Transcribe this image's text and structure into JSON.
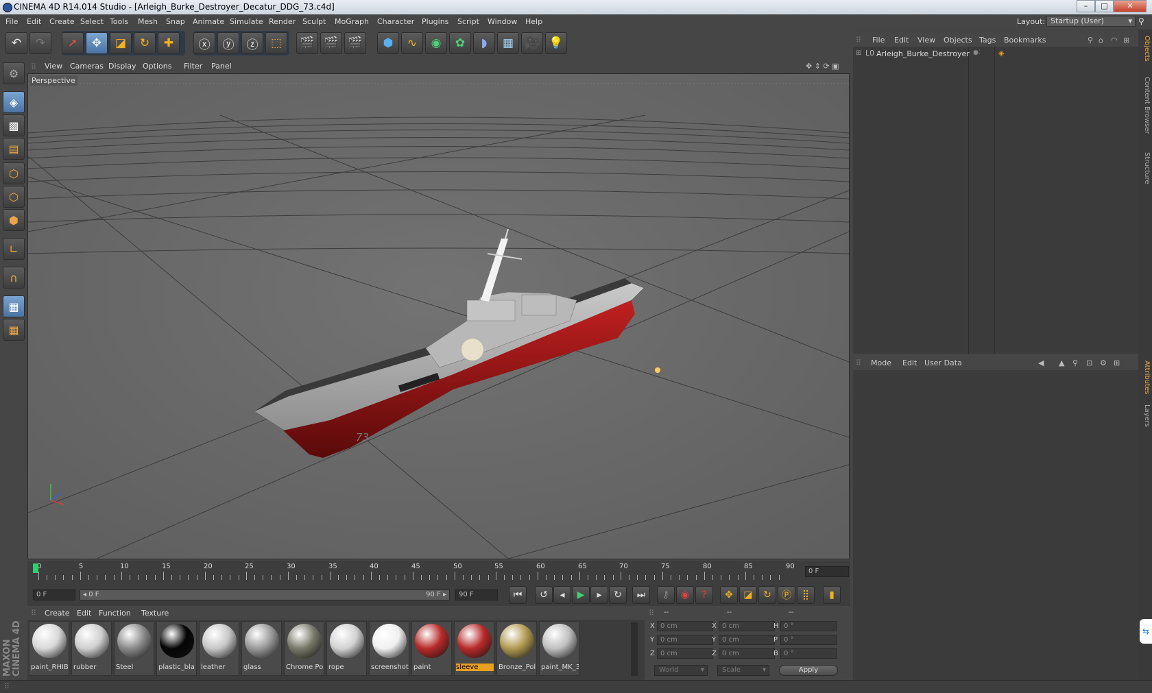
{
  "window": {
    "title": "CINEMA 4D R14.014 Studio - [Arleigh_Burke_Destroyer_Decatur_DDG_73.c4d]",
    "minimize": "–",
    "maximize": "□",
    "close": "✕"
  },
  "menubar": {
    "items": [
      "File",
      "Edit",
      "Create",
      "Select",
      "Tools",
      "Mesh",
      "Snap",
      "Animate",
      "Simulate",
      "Render",
      "Sculpt",
      "MoGraph",
      "Character",
      "Plugins",
      "Script",
      "Window",
      "Help"
    ],
    "layout_label": "Layout:",
    "layout_value": "Startup (User)"
  },
  "viewport": {
    "menu": [
      "View",
      "Cameras",
      "Display",
      "Options",
      "Filter",
      "Panel"
    ],
    "label": "Perspective",
    "hull_number": "73"
  },
  "timeline": {
    "ticks": [
      "0",
      "5",
      "10",
      "15",
      "20",
      "25",
      "30",
      "35",
      "40",
      "45",
      "50",
      "55",
      "60",
      "65",
      "70",
      "75",
      "80",
      "85",
      "90"
    ],
    "current_frame": "0 F",
    "start_field": "0 F",
    "range_start": "◂ 0 F",
    "range_end": "90 F ▸",
    "end_field": "90 F"
  },
  "materials": {
    "menu": [
      "Create",
      "Edit",
      "Function",
      "Texture"
    ],
    "items": [
      {
        "name": "paint_RHIB",
        "color": "#d8d8d8",
        "selected": false
      },
      {
        "name": "rubber",
        "color": "#cfcfcf",
        "selected": false
      },
      {
        "name": "Steel",
        "color": "#8a8a8a",
        "selected": false
      },
      {
        "name": "plastic_bla",
        "color": "#050505",
        "selected": false
      },
      {
        "name": "leather",
        "color": "#c8c8c8",
        "selected": false
      },
      {
        "name": "glass",
        "color": "#9a9a9a",
        "selected": false
      },
      {
        "name": "Chrome Po",
        "color": "#7a7a6a",
        "selected": false
      },
      {
        "name": "rope",
        "color": "#d2d2d2",
        "selected": false
      },
      {
        "name": "screenshot",
        "color": "#f0f0f0",
        "selected": false
      },
      {
        "name": "paint",
        "color": "#b82a2a",
        "selected": false
      },
      {
        "name": "sleeve",
        "color": "#b82a2a",
        "selected": true
      },
      {
        "name": "Bronze_Pol",
        "color": "#b09a50",
        "selected": false
      },
      {
        "name": "paint_MK_3",
        "color": "#c0c0c0",
        "selected": false
      }
    ]
  },
  "coords": {
    "headers": [
      "--",
      "--",
      "--"
    ],
    "rows": [
      {
        "l1": "X",
        "v1": "0 cm",
        "l2": "X",
        "v2": "0 cm",
        "l3": "H",
        "v3": "0 °"
      },
      {
        "l1": "Y",
        "v1": "0 cm",
        "l2": "Y",
        "v2": "0 cm",
        "l3": "P",
        "v3": "0 °"
      },
      {
        "l1": "Z",
        "v1": "0 cm",
        "l2": "Z",
        "v2": "0 cm",
        "l3": "B",
        "v3": "0 °"
      }
    ],
    "world": "World",
    "scale": "Scale",
    "apply": "Apply"
  },
  "object_manager": {
    "menu": [
      "File",
      "Edit",
      "View",
      "Objects",
      "Tags",
      "Bookmarks"
    ],
    "objects": [
      {
        "name": "Arleigh_Burke_Destroyer"
      }
    ]
  },
  "attribute_manager": {
    "menu": [
      "Mode",
      "Edit",
      "User Data"
    ]
  },
  "side_tabs": {
    "top": [
      "Objects",
      "Content Browser",
      "Structure"
    ],
    "bottom": [
      "Attributes",
      "Layers"
    ]
  },
  "brand": {
    "line1": "MAXON",
    "line2": "CINEMA 4D"
  }
}
